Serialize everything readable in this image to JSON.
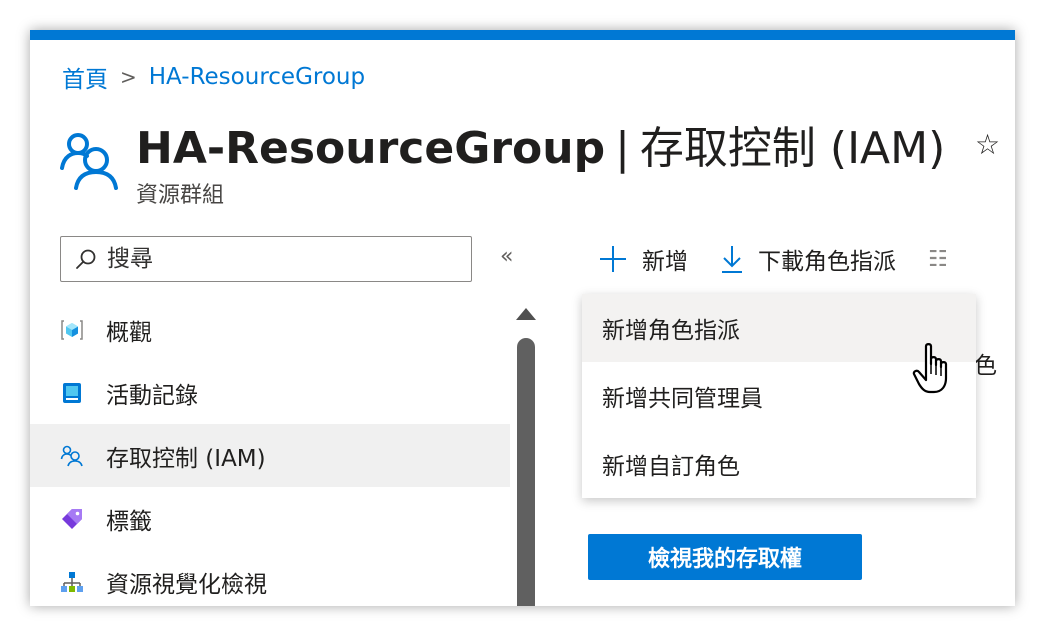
{
  "breadcrumb": {
    "home": "首頁",
    "separator": ">",
    "current": "HA-ResourceGroup"
  },
  "header": {
    "resource_name": "HA-ResourceGroup",
    "separator": "|",
    "section": "存取控制 (IAM)",
    "subtitle": "資源群組",
    "favorite_icon": "star-icon",
    "favorite_glyph": "☆"
  },
  "search": {
    "placeholder": "搜尋",
    "value": ""
  },
  "collapse_glyph": "«",
  "nav": {
    "items": [
      {
        "label": "概觀",
        "icon": "overview-cube-icon",
        "active": false
      },
      {
        "label": "活動記錄",
        "icon": "activity-log-icon",
        "active": false
      },
      {
        "label": "存取控制 (IAM)",
        "icon": "people-icon",
        "active": true
      },
      {
        "label": "標籤",
        "icon": "tag-icon",
        "active": false
      },
      {
        "label": "資源視覺化檢視",
        "icon": "hierarchy-icon",
        "active": false
      }
    ]
  },
  "toolbar": {
    "add_label": "新增",
    "download_label": "下載角色指派",
    "more_glyph": "☷"
  },
  "add_menu": {
    "items": [
      {
        "label": "新增角色指派",
        "hovered": true
      },
      {
        "label": "新增共同管理員",
        "hovered": false
      },
      {
        "label": "新增自訂角色",
        "hovered": false
      }
    ]
  },
  "behind_partial_text": "色",
  "view_access_button": "檢視我的存取權",
  "colors": {
    "accent": "#0078d4",
    "active_nav": "#f0f0f0"
  }
}
